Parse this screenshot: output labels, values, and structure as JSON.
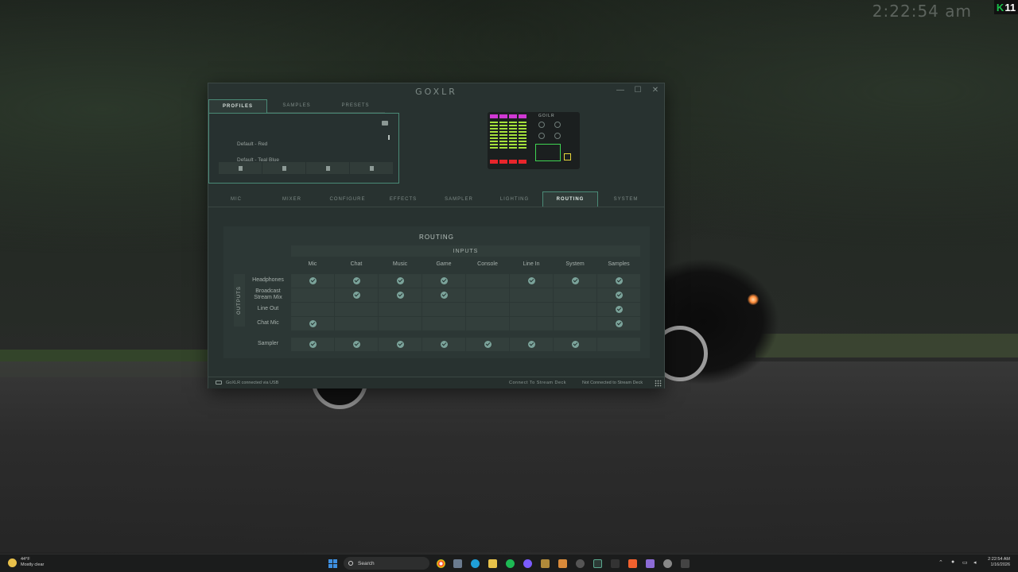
{
  "desktop": {
    "clock": "2:22:54 am",
    "badge": "11"
  },
  "window": {
    "logo": "GOXLR",
    "controls": {
      "minimize": "—",
      "maximize": "☐",
      "close": "✕"
    },
    "top_tabs": [
      "PROFILES",
      "SAMPLES",
      "PRESETS"
    ],
    "active_top_tab": "PROFILES",
    "profiles": [
      "Default - Red",
      "Default - Teal Blue"
    ],
    "main_tabs": [
      "MIC",
      "MIXER",
      "CONFIGURE",
      "EFFECTS",
      "SAMPLER",
      "LIGHTING",
      "ROUTING",
      "SYSTEM"
    ],
    "active_main_tab": "ROUTING",
    "device_logo": "GO/LR"
  },
  "routing": {
    "title": "ROUTING",
    "inputs_header": "INPUTS",
    "outputs_header": "OUTPUTS",
    "columns": [
      "Mic",
      "Chat",
      "Music",
      "Game",
      "Console",
      "Line In",
      "System",
      "Samples"
    ],
    "rows": [
      {
        "label": "Headphones",
        "checks": [
          true,
          true,
          true,
          true,
          false,
          true,
          true,
          true
        ]
      },
      {
        "label": "Broadcast Stream Mix",
        "checks": [
          false,
          true,
          true,
          true,
          false,
          false,
          false,
          true
        ]
      },
      {
        "label": "Line Out",
        "checks": [
          false,
          false,
          false,
          false,
          false,
          false,
          false,
          true
        ]
      },
      {
        "label": "Chat Mic",
        "checks": [
          true,
          false,
          false,
          false,
          false,
          false,
          false,
          true
        ]
      }
    ],
    "sampler_row": {
      "label": "Sampler",
      "checks": [
        true,
        true,
        true,
        true,
        true,
        true,
        true,
        false
      ]
    }
  },
  "status": {
    "connection": "GoXLR connected via USB",
    "stream_deck_button": "Connect To Stream Deck",
    "stream_deck_status": "Not Connected to Stream Deck"
  },
  "taskbar": {
    "temperature": "44°F",
    "weather": "Mostly clear",
    "search": "Search",
    "time": "2:22:54 AM",
    "date": "1/16/2026"
  },
  "colors": {
    "accent": "#4a8a76",
    "check": "#7ba39a",
    "window_bg": "#283230"
  }
}
